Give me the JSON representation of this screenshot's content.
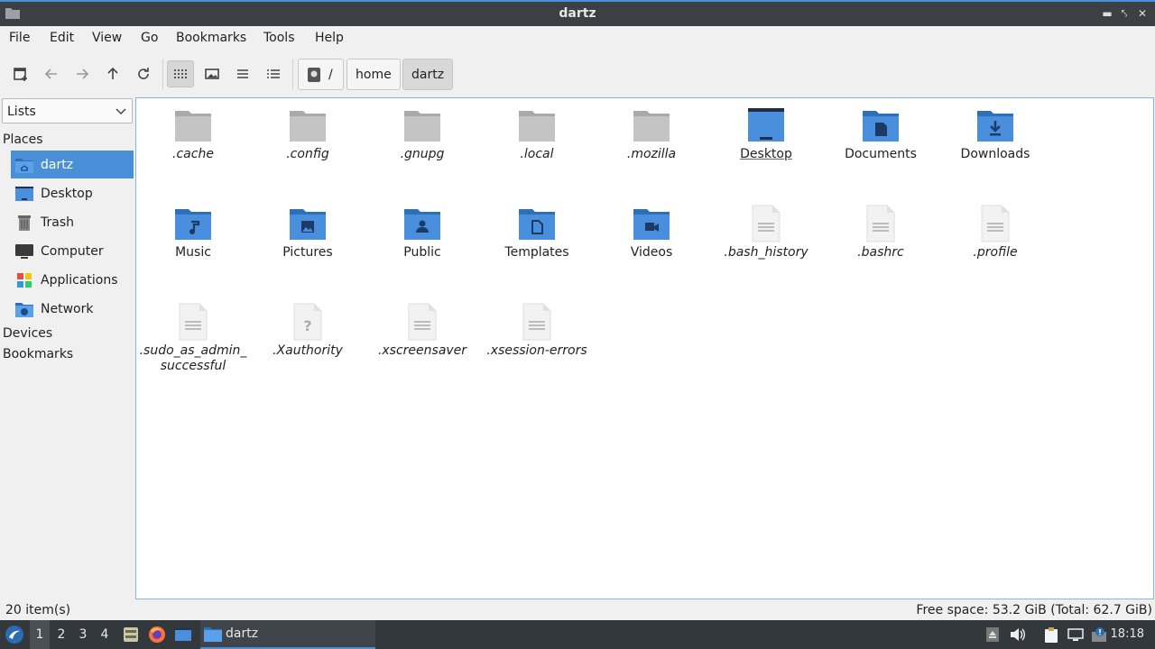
{
  "window": {
    "title": "dartz"
  },
  "menu": [
    "File",
    "Edit",
    "View",
    "Go",
    "Bookmarks",
    "Tools",
    "Help"
  ],
  "breadcrumb": {
    "root": "/",
    "segments": [
      "home",
      "dartz"
    ]
  },
  "sidebar": {
    "selector": "Lists",
    "places_heading": "Places",
    "places": [
      {
        "label": "dartz",
        "icon": "home-folder-icon"
      },
      {
        "label": "Desktop",
        "icon": "desktop-icon"
      },
      {
        "label": "Trash",
        "icon": "trash-icon"
      },
      {
        "label": "Computer",
        "icon": "computer-icon"
      },
      {
        "label": "Applications",
        "icon": "applications-icon"
      },
      {
        "label": "Network",
        "icon": "network-icon"
      }
    ],
    "devices_heading": "Devices",
    "bookmarks_heading": "Bookmarks"
  },
  "files": [
    {
      "name": ".cache",
      "type": "folder-gray"
    },
    {
      "name": ".config",
      "type": "folder-gray"
    },
    {
      "name": ".gnupg",
      "type": "folder-gray"
    },
    {
      "name": ".local",
      "type": "folder-gray"
    },
    {
      "name": ".mozilla",
      "type": "folder-gray"
    },
    {
      "name": "Desktop",
      "type": "desktop"
    },
    {
      "name": "Documents",
      "type": "folder-documents"
    },
    {
      "name": "Downloads",
      "type": "folder-downloads"
    },
    {
      "name": "Music",
      "type": "folder-music"
    },
    {
      "name": "Pictures",
      "type": "folder-pictures"
    },
    {
      "name": "Public",
      "type": "folder-public"
    },
    {
      "name": "Templates",
      "type": "folder-templates"
    },
    {
      "name": "Videos",
      "type": "folder-videos"
    },
    {
      "name": ".bash_history",
      "type": "text"
    },
    {
      "name": ".bashrc",
      "type": "text"
    },
    {
      "name": ".profile",
      "type": "text"
    },
    {
      "name": ".sudo_as_admin_ successful",
      "type": "text"
    },
    {
      "name": ".Xauthority",
      "type": "unknown"
    },
    {
      "name": ".xscreensaver",
      "type": "text"
    },
    {
      "name": ".xsession-errors",
      "type": "text"
    }
  ],
  "status": {
    "items": "20 item(s)",
    "free_space": "Free space: 53.2 GiB (Total: 62.7 GiB)"
  },
  "taskbar": {
    "workspaces": [
      "1",
      "2",
      "3",
      "4"
    ],
    "active_workspace": "1",
    "window_label": "dartz",
    "clock": "18:18"
  },
  "colors": {
    "accent": "#4a90d9",
    "folder_blue": "#4a8fde",
    "folder_gray": "#bdbdbd"
  }
}
